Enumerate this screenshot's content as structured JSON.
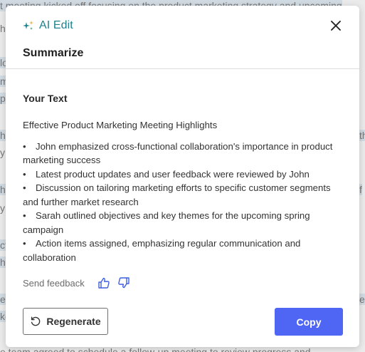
{
  "background_doc": {
    "lines": [
      "t meeting kicked off focusing on the product marketing strategy and upcoming",
      "ha",
      "lo",
      "m",
      "p",
      "he",
      "y",
      "he",
      "y",
      "ct",
      "h",
      "e",
      "ke",
      "e team agreed to schedule a follow-up meeting to review progress and"
    ]
  },
  "modal": {
    "brand_label": "AI Edit",
    "title": "Summarize",
    "section_label": "Your Text",
    "summary_title": "Effective Product Marketing Meeting Highlights",
    "bullets": [
      "John emphasized cross-functional collaboration's importance in product marketing success",
      "Latest product updates and user feedback were reviewed by John",
      "Discussion on tailoring marketing efforts to specific customer segments and further market research",
      "Sarah outlined objectives and key themes for the upcoming spring campaign",
      "Action items assigned, emphasizing regular communication and collaboration"
    ],
    "feedback_label": "Send feedback",
    "regenerate_label": "Regenerate",
    "copy_label": "Copy"
  },
  "colors": {
    "brand": "#1e7f8f",
    "primary_button": "#4f66f4",
    "thumb_icon": "#3d5ee0",
    "highlight": "#cfe0ee"
  },
  "icons": {
    "brand": "sparkle-icon",
    "close": "close-icon",
    "thumbs_up": "thumbs-up-icon",
    "thumbs_down": "thumbs-down-icon",
    "regenerate": "refresh-icon"
  }
}
